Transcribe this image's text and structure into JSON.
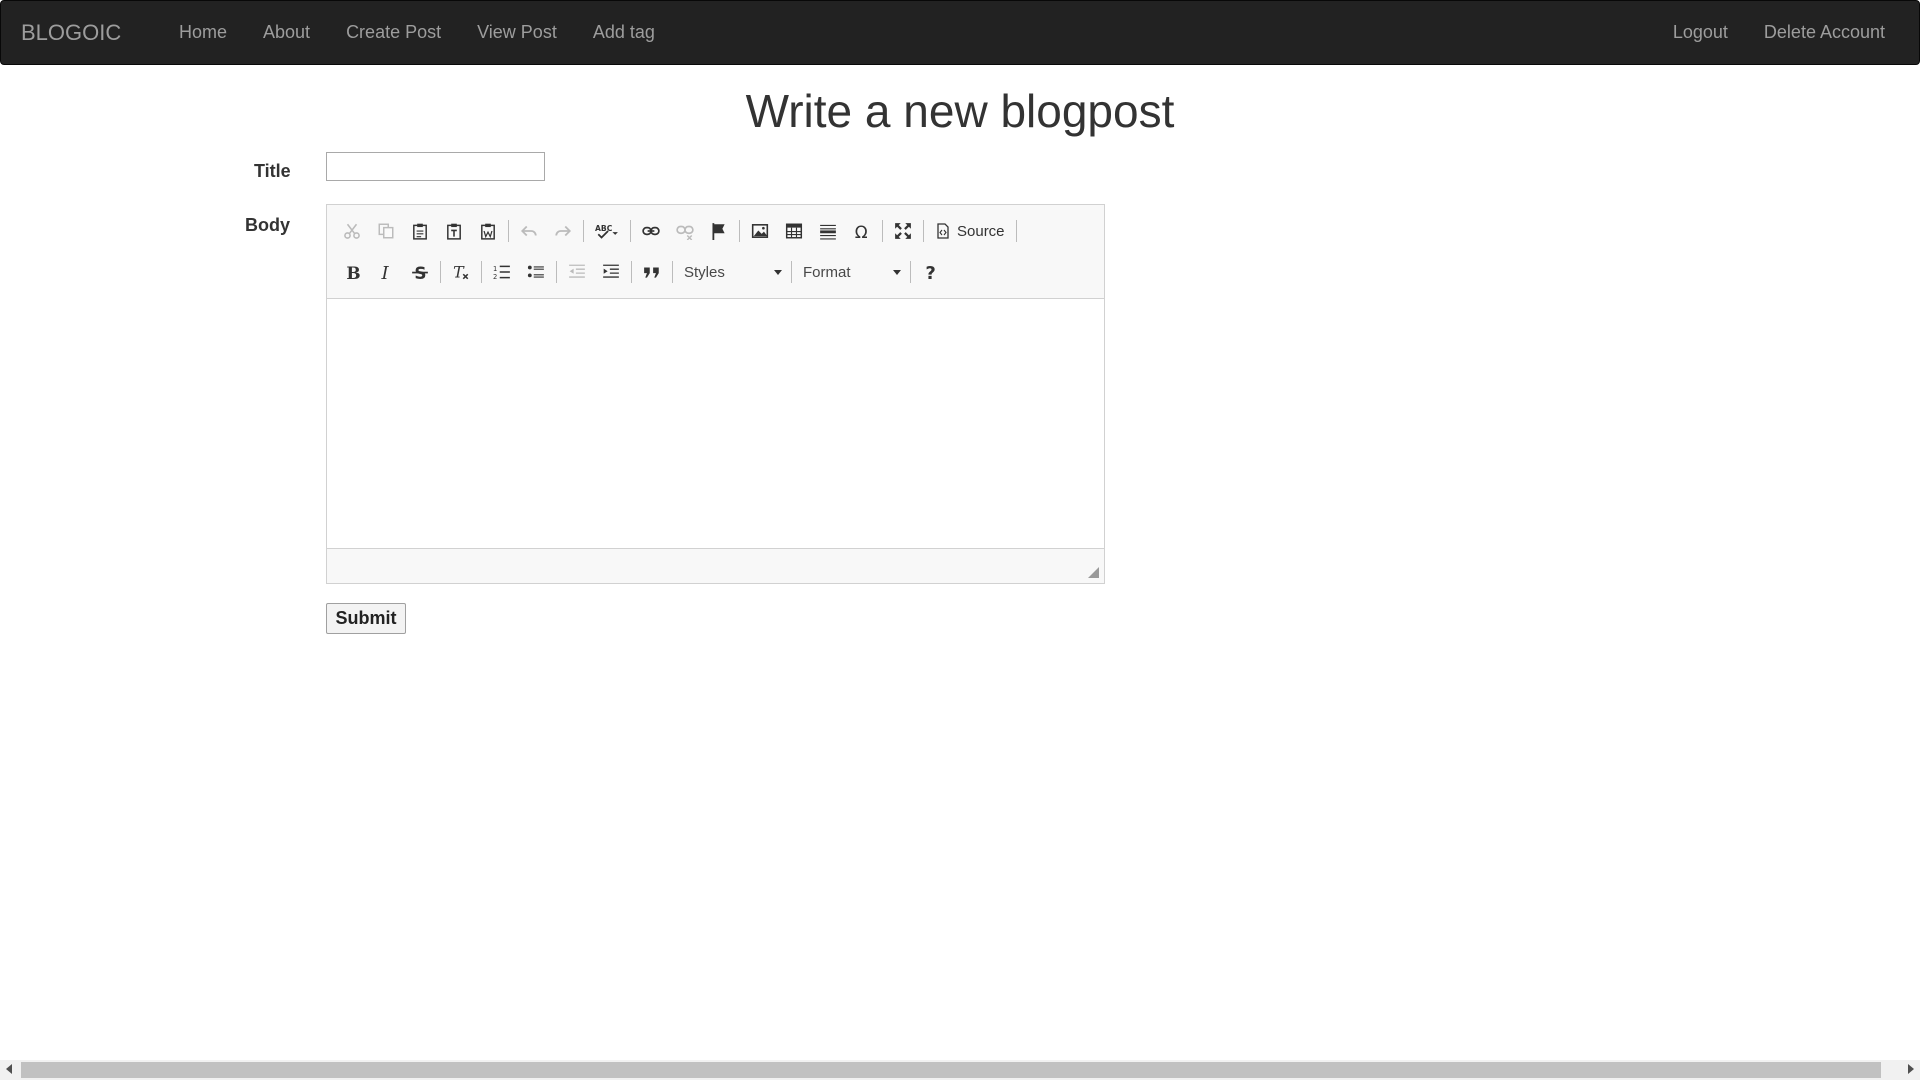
{
  "navbar": {
    "brand": "BLOGOIC",
    "left_links": [
      "Home",
      "About",
      "Create Post",
      "View Post",
      "Add tag"
    ],
    "right_links": [
      "Logout",
      "Delete Account"
    ]
  },
  "page": {
    "title": "Write a new blogpost"
  },
  "form": {
    "title_label": "Title",
    "title_value": "",
    "body_label": "Body",
    "submit_label": "Submit"
  },
  "editor": {
    "toolbar_row1": [
      "cut-icon",
      "copy-icon",
      "paste-icon",
      "paste-text-icon",
      "paste-word-icon",
      "undo-icon",
      "redo-icon",
      "spellcheck-icon",
      "link-icon",
      "unlink-icon",
      "anchor-icon",
      "image-icon",
      "table-icon",
      "horizontal-rule-icon",
      "special-char-icon",
      "maximize-icon"
    ],
    "source_label": "Source",
    "toolbar_row2": [
      "bold-icon",
      "italic-icon",
      "strikethrough-icon",
      "remove-format-icon",
      "numbered-list-icon",
      "bulleted-list-icon",
      "outdent-icon",
      "indent-icon",
      "blockquote-icon"
    ],
    "styles_label": "Styles",
    "format_label": "Format",
    "help_icon": "help-icon"
  },
  "colors": {
    "navbar_bg": "#222222",
    "navbar_text": "#9d9d9d",
    "toolbar_bg": "#f8f8f8"
  }
}
